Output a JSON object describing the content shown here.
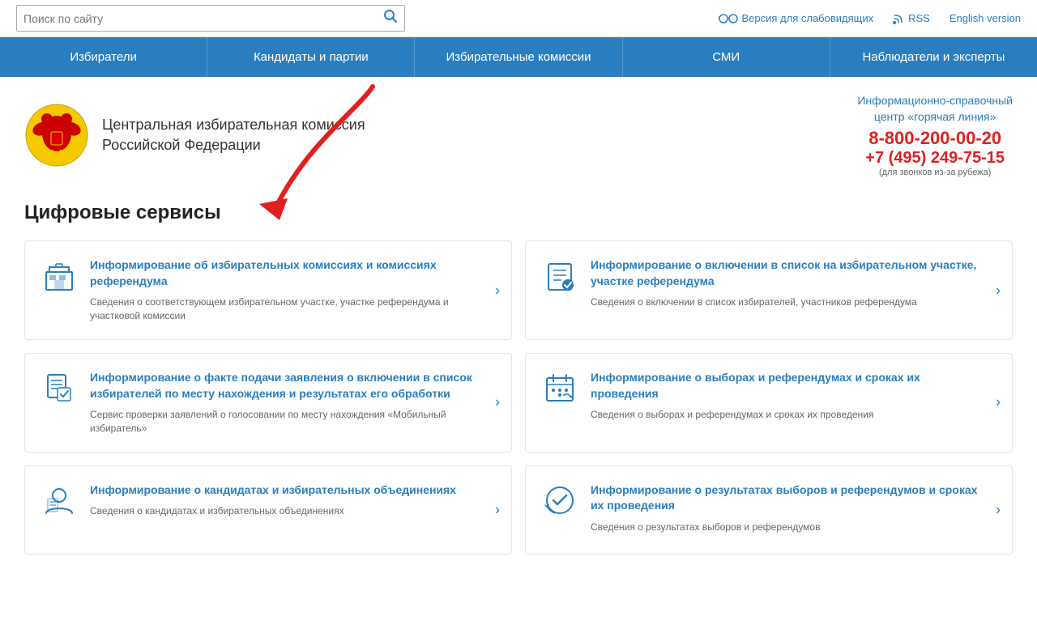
{
  "topbar": {
    "search_placeholder": "Поиск по сайту",
    "vision_label": "Версия для слабовидящих",
    "rss_label": "RSS",
    "english_label": "English version"
  },
  "nav": {
    "items": [
      {
        "id": "voters",
        "label": "Избиратели"
      },
      {
        "id": "candidates",
        "label": "Кандидаты и партии"
      },
      {
        "id": "commissions",
        "label": "Избирательные комиссии"
      },
      {
        "id": "media",
        "label": "СМИ"
      },
      {
        "id": "observers",
        "label": "Наблюдатели и эксперты"
      }
    ]
  },
  "header": {
    "org_name_line1": "Центральная избирательная комиссия",
    "org_name_line2": "Российской Федерации",
    "hotline_title_line1": "Информационно-справочный",
    "hotline_title_line2": "центр «горячая линия»",
    "hotline_number1": "8-800-200-00-20",
    "hotline_number2": "+7 (495) 249-75-15",
    "hotline_note": "(для звонков из-за рубежа)"
  },
  "main": {
    "section_title": "Цифровые сервисы",
    "services": [
      {
        "id": "commission-info",
        "title": "Информирование об избирательных комиссиях и комиссиях референдума",
        "desc": "Сведения о соответствующем избирательном участке, участке референдума и участковой комиссии",
        "icon": "commission-icon"
      },
      {
        "id": "inclusion-info",
        "title": "Информирование о включении в список на избирательном участке, участке референдума",
        "desc": "Сведения о включении в список избирателей, участников референдума",
        "icon": "list-icon"
      },
      {
        "id": "application-info",
        "title": "Информирование о факте подачи заявления о включении в список избирателей по месту нахождения и результатах его обработки",
        "desc": "Сервис проверки заявлений о голосовании по месту нахождения «Мобильный избиратель»",
        "icon": "document-icon"
      },
      {
        "id": "elections-info",
        "title": "Информирование о выборах и референдумах и сроках их проведения",
        "desc": "Сведения о выборах и референдумах и сроках их проведения",
        "icon": "calendar-icon"
      },
      {
        "id": "candidates-info",
        "title": "Информирование о кандидатах и избирательных объединениях",
        "desc": "Сведения о кандидатах и избирательных объединениях",
        "icon": "person-icon"
      },
      {
        "id": "results-info",
        "title": "Информирование о результатах выборов и референдумов и сроках их проведения",
        "desc": "Сведения о результатах выборов и референдумов",
        "icon": "results-icon"
      }
    ]
  },
  "colors": {
    "blue": "#2a7ec0",
    "red": "#e02020",
    "nav_bg": "#2a7ec0"
  }
}
